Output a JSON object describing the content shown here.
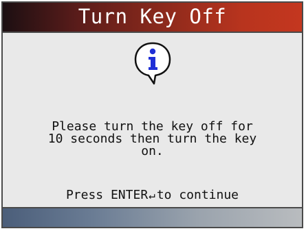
{
  "screen": {
    "title": "Turn Key Off",
    "icon": "info-speech-bubble-icon",
    "message_lines": [
      "Please turn the key off for",
      "10 seconds then turn the key",
      "on."
    ],
    "prompt_before": "Press ENTER",
    "prompt_glyph": "↵",
    "prompt_after": "to continue"
  },
  "colors": {
    "title_bar_start": "#1c0f12",
    "title_bar_end": "#c4371f",
    "title_text": "#ffffff",
    "content_background": "#e9e9e9",
    "icon_blue": "#1f2fd6",
    "bottom_bar_start": "#4b5e7a",
    "bottom_bar_end": "#b9bcbf"
  }
}
